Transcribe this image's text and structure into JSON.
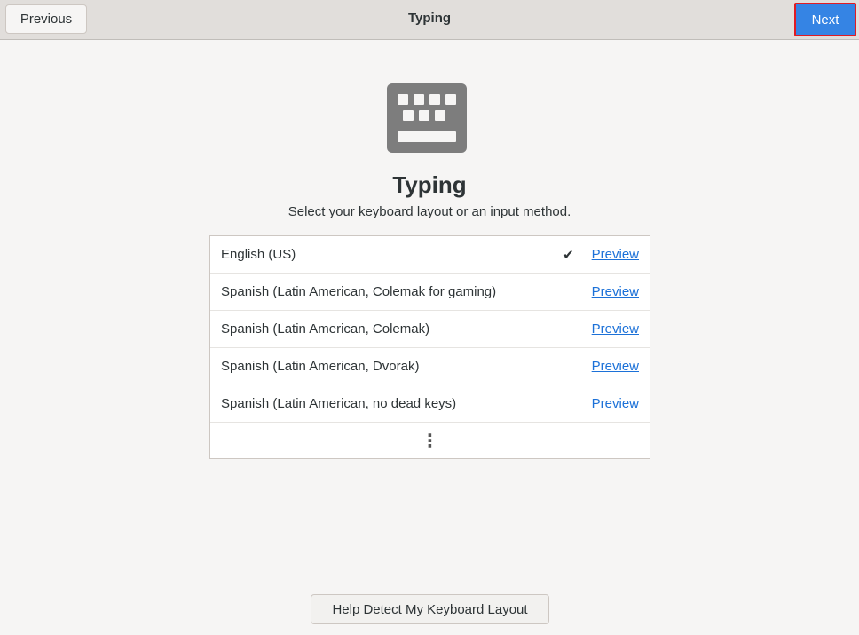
{
  "header": {
    "title": "Typing",
    "previous_label": "Previous",
    "next_label": "Next"
  },
  "main": {
    "icon": "keyboard-icon",
    "title": "Typing",
    "subtitle": "Select your keyboard layout or an input method.",
    "layouts": [
      {
        "label": "English (US)",
        "selected": true,
        "preview": "Preview"
      },
      {
        "label": "Spanish (Latin American, Colemak for gaming)",
        "selected": false,
        "preview": "Preview"
      },
      {
        "label": "Spanish (Latin American, Colemak)",
        "selected": false,
        "preview": "Preview"
      },
      {
        "label": "Spanish (Latin American, Dvorak)",
        "selected": false,
        "preview": "Preview"
      },
      {
        "label": "Spanish (Latin American, no dead keys)",
        "selected": false,
        "preview": "Preview"
      }
    ],
    "more_icon": "⋮",
    "help_label": "Help Detect My Keyboard Layout"
  },
  "colors": {
    "accent": "#3584e4",
    "link": "#1c71d8"
  }
}
